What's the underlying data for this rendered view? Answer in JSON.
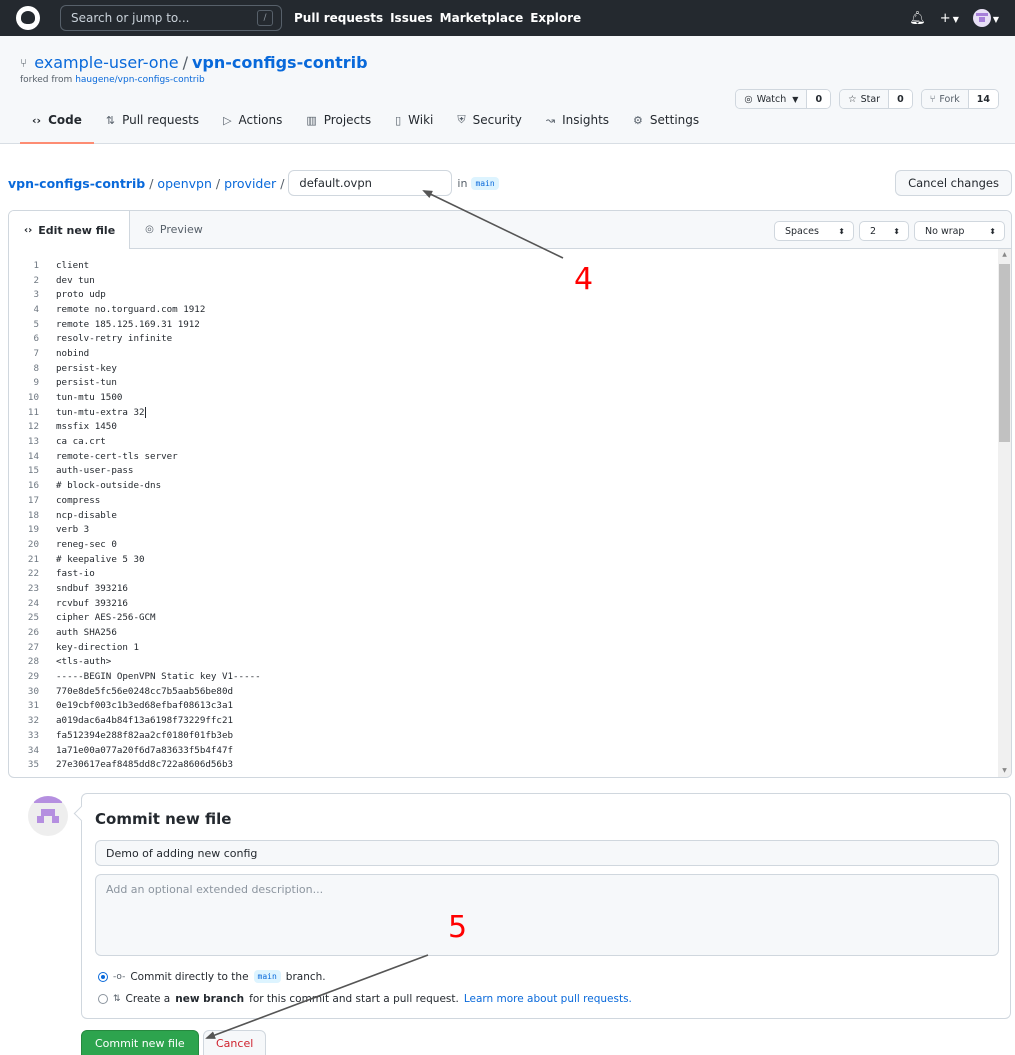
{
  "topbar": {
    "logo": "github-logo",
    "search_placeholder": "Search or jump to...",
    "search_shortcut": "/",
    "nav": [
      "Pull requests",
      "Issues",
      "Marketplace",
      "Explore"
    ],
    "icons": [
      "bell-icon",
      "plus-icon",
      "avatar"
    ]
  },
  "repo": {
    "owner": "example-user-one",
    "separator": "/",
    "name": "vpn-configs-contrib",
    "forked_prefix": "forked from",
    "forked_from": "haugene/vpn-configs-contrib",
    "watch_label": "Watch",
    "watch_count": "0",
    "star_label": "Star",
    "star_count": "0",
    "fork_label": "Fork",
    "fork_count": "14"
  },
  "tabs": [
    {
      "label": "Code",
      "icon": "code-icon",
      "active": true
    },
    {
      "label": "Pull requests",
      "icon": "pull-request-icon"
    },
    {
      "label": "Actions",
      "icon": "play-icon"
    },
    {
      "label": "Projects",
      "icon": "project-icon"
    },
    {
      "label": "Wiki",
      "icon": "book-icon"
    },
    {
      "label": "Security",
      "icon": "shield-icon"
    },
    {
      "label": "Insights",
      "icon": "graph-icon"
    },
    {
      "label": "Settings",
      "icon": "gear-icon"
    }
  ],
  "breadcrumb": {
    "root": "vpn-configs-contrib",
    "parts": [
      "openvpn",
      "provider"
    ],
    "sep": "/",
    "filename": "default.ovpn",
    "in_label": "in",
    "branch": "main",
    "cancel_changes": "Cancel changes"
  },
  "editor": {
    "tab_edit": "Edit new file",
    "tab_preview": "Preview",
    "indent_mode": "Spaces",
    "indent_size": "2",
    "wrap_mode": "No wrap",
    "cursor_line": 11,
    "lines": [
      "client",
      "dev tun",
      "proto udp",
      "remote no.torguard.com 1912",
      "remote 185.125.169.31 1912",
      "resolv-retry infinite",
      "nobind",
      "persist-key",
      "persist-tun",
      "tun-mtu 1500",
      "tun-mtu-extra 32",
      "mssfix 1450",
      "ca ca.crt",
      "remote-cert-tls server",
      "auth-user-pass",
      "# block-outside-dns",
      "compress",
      "ncp-disable",
      "verb 3",
      "reneg-sec 0",
      "# keepalive 5 30",
      "fast-io",
      "sndbuf 393216",
      "rcvbuf 393216",
      "cipher AES-256-GCM",
      "auth SHA256",
      "key-direction 1",
      "<tls-auth>",
      "-----BEGIN OpenVPN Static key V1-----",
      "770e8de5fc56e0248cc7b5aab56be80d",
      "0e19cbf003c1b3ed68efbaf08613c3a1",
      "a019dac6a4b84f13a6198f73229ffc21",
      "fa512394e288f82aa2cf0180f01fb3eb",
      "1a71e00a077a20f6d7a83633f5b4f47f",
      "27e30617eaf8485dd8c722a8606d56b3"
    ]
  },
  "commit": {
    "title": "Commit new file",
    "summary_value": "Demo of adding new config",
    "description_placeholder": "Add an optional extended description...",
    "option_direct_prefix": "Commit directly to the",
    "option_direct_branch": "main",
    "option_direct_suffix": "branch.",
    "option_new_prefix": "Create a",
    "option_new_bold": "new branch",
    "option_new_suffix": "for this commit and start a pull request.",
    "option_new_link": "Learn more about pull requests.",
    "selected_option": "direct",
    "commit_button": "Commit new file",
    "cancel_button": "Cancel"
  },
  "annotations": {
    "step4": "4",
    "step5": "5",
    "color": "#ff0000"
  },
  "colors": {
    "header_bg": "#24292f",
    "link": "#0969da",
    "primary_button": "#2da44e",
    "active_tab_underline": "#fd8c73",
    "danger_text": "#cf222e"
  }
}
